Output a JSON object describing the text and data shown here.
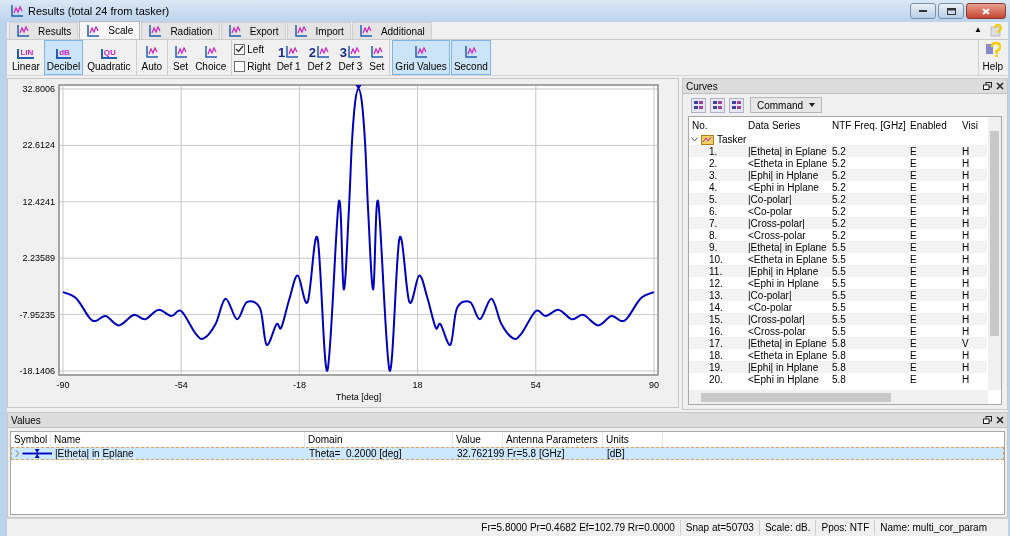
{
  "window": {
    "title": "Results (total 24 from tasker)"
  },
  "tabs": [
    {
      "label": "Results",
      "selected": false
    },
    {
      "label": "Scale",
      "selected": true
    },
    {
      "label": "Radiation",
      "selected": false
    },
    {
      "label": "Export",
      "selected": false
    },
    {
      "label": "Import",
      "selected": false
    },
    {
      "label": "Additional",
      "selected": false
    }
  ],
  "tab_bar_right": {
    "collapse": "▲"
  },
  "toolbar": {
    "groups": [
      [
        {
          "kind": "button",
          "label": "Linear",
          "icon_text": "LIN",
          "selected": false
        },
        {
          "kind": "button",
          "label": "Decibel",
          "icon_text": "dB",
          "selected": true
        },
        {
          "kind": "button",
          "label": "Quadratic",
          "icon_text": "QU",
          "selected": false
        }
      ],
      [
        {
          "kind": "button",
          "label": "Auto",
          "selected": false
        }
      ],
      [
        {
          "kind": "button",
          "label": "Set",
          "selected": false
        },
        {
          "kind": "button",
          "label": "Choice",
          "selected": false
        }
      ],
      [
        {
          "kind": "checkbox",
          "label": "Left",
          "checked": true
        },
        {
          "kind": "checkbox",
          "label": "Right",
          "checked": false
        },
        {
          "kind": "button",
          "label": "Def 1",
          "icon_text": "1",
          "selected": false
        },
        {
          "kind": "button",
          "label": "Def 2",
          "icon_text": "2",
          "selected": false
        },
        {
          "kind": "button",
          "label": "Def 3",
          "icon_text": "3",
          "selected": false
        },
        {
          "kind": "button",
          "label": "Set",
          "selected": false
        }
      ],
      [
        {
          "kind": "button",
          "label": "Grid Values",
          "selected": true
        },
        {
          "kind": "button",
          "label": "Second",
          "selected": true
        }
      ]
    ],
    "help": {
      "label": "Help"
    }
  },
  "chart": {
    "chart_data": {
      "type": "line",
      "grid": true,
      "xlabel": "Theta [deg]",
      "x": [
        -90,
        -86,
        -82,
        -80,
        -77,
        -73,
        -68.5,
        -65,
        -61,
        -57,
        -54,
        -49.5,
        -47,
        -43.5,
        -40.5,
        -37,
        -34,
        -30,
        -28,
        -25,
        -23.5,
        -21,
        -18.5,
        -15.5,
        -12.5,
        -9.5,
        -6,
        -4.5,
        -3,
        -2,
        -1,
        0,
        1,
        2,
        3,
        4.5,
        6,
        9.5,
        12.5,
        15.5,
        18.5,
        21,
        23.5,
        25,
        28,
        30,
        34,
        37,
        40.5,
        43.5,
        47,
        49.5,
        54,
        57,
        61,
        65,
        68.5,
        73,
        77,
        80,
        82,
        86,
        90
      ],
      "series": [
        {
          "color": "#0000c0",
          "values": [
            -3.9,
            -5,
            -8.5,
            -9.1,
            -8.2,
            -9.9,
            -8,
            -8.8,
            -7.1,
            -8.2,
            -7.3,
            -11.5,
            -12.2,
            -9.6,
            -5.1,
            -8.8,
            -5.7,
            -6.8,
            -13.4,
            -9.7,
            -10.3,
            -5,
            -0.9,
            -5.7,
            5.9,
            -18.1,
            12.4,
            -3.4,
            10,
            23,
            30.5,
            32.8,
            30.5,
            23,
            10,
            -3.4,
            12.4,
            -18.1,
            5.9,
            -5.7,
            -0.9,
            -5,
            -10.3,
            -9.7,
            -13.4,
            -6.8,
            -5.7,
            -8.8,
            -5.1,
            -9.6,
            -12.2,
            -11.5,
            -7.3,
            -8.2,
            -7.1,
            -8.8,
            -8,
            -9.9,
            -8.2,
            -9.1,
            -8.5,
            -5,
            -3.9
          ]
        }
      ],
      "xlim": [
        -90,
        90
      ],
      "ylim": [
        -18.1406,
        32.8006
      ],
      "xticks": [
        -90,
        -54,
        -18,
        18,
        54,
        90
      ],
      "yticks": [
        {
          "value": 32.8006,
          "label": "32.8006"
        },
        {
          "value": 22.6124,
          "label": "22.6124"
        },
        {
          "value": 12.4241,
          "label": "12.4241"
        },
        {
          "value": 2.23589,
          "label": "2.23589"
        },
        {
          "value": -7.95235,
          "label": "-7.95235"
        },
        {
          "value": -18.1406,
          "label": "-18.1406"
        }
      ]
    }
  },
  "curves": {
    "title": "Curves",
    "command": "Command",
    "columns": [
      "No.",
      "Data Series",
      "NTF Freq. [GHz]",
      "Enabled",
      "Visi"
    ],
    "tree": {
      "label": "Tasker",
      "expanded": true,
      "children": [
        {
          "no": "1.",
          "series": "|Etheta| in Eplane",
          "freq": "5.2",
          "enabled": "E",
          "visible": "H"
        },
        {
          "no": "2.",
          "series": "<Etheta in Eplane",
          "freq": "5.2",
          "enabled": "E",
          "visible": "H"
        },
        {
          "no": "3.",
          "series": "|Ephi| in Hplane",
          "freq": "5.2",
          "enabled": "E",
          "visible": "H"
        },
        {
          "no": "4.",
          "series": "<Ephi in Hplane",
          "freq": "5.2",
          "enabled": "E",
          "visible": "H"
        },
        {
          "no": "5.",
          "series": "|Co-polar|",
          "freq": "5.2",
          "enabled": "E",
          "visible": "H"
        },
        {
          "no": "6.",
          "series": "<Co-polar",
          "freq": "5.2",
          "enabled": "E",
          "visible": "H"
        },
        {
          "no": "7.",
          "series": "|Cross-polar|",
          "freq": "5.2",
          "enabled": "E",
          "visible": "H"
        },
        {
          "no": "8.",
          "series": "<Cross-polar",
          "freq": "5.2",
          "enabled": "E",
          "visible": "H"
        },
        {
          "no": "9.",
          "series": "|Etheta| in Eplane",
          "freq": "5.5",
          "enabled": "E",
          "visible": "H"
        },
        {
          "no": "10.",
          "series": "<Etheta in Eplane",
          "freq": "5.5",
          "enabled": "E",
          "visible": "H"
        },
        {
          "no": "11.",
          "series": "|Ephi| in Hplane",
          "freq": "5.5",
          "enabled": "E",
          "visible": "H"
        },
        {
          "no": "12.",
          "series": "<Ephi in Hplane",
          "freq": "5.5",
          "enabled": "E",
          "visible": "H"
        },
        {
          "no": "13.",
          "series": "|Co-polar|",
          "freq": "5.5",
          "enabled": "E",
          "visible": "H"
        },
        {
          "no": "14.",
          "series": "<Co-polar",
          "freq": "5.5",
          "enabled": "E",
          "visible": "H"
        },
        {
          "no": "15.",
          "series": "|Cross-polar|",
          "freq": "5.5",
          "enabled": "E",
          "visible": "H"
        },
        {
          "no": "16.",
          "series": "<Cross-polar",
          "freq": "5.5",
          "enabled": "E",
          "visible": "H"
        },
        {
          "no": "17.",
          "series": "|Etheta| in Eplane",
          "freq": "5.8",
          "enabled": "E",
          "visible": "V"
        },
        {
          "no": "18.",
          "series": "<Etheta in Eplane",
          "freq": "5.8",
          "enabled": "E",
          "visible": "H"
        },
        {
          "no": "19.",
          "series": "|Ephi| in Hplane",
          "freq": "5.8",
          "enabled": "E",
          "visible": "H"
        },
        {
          "no": "20.",
          "series": "<Ephi in Hplane",
          "freq": "5.8",
          "enabled": "E",
          "visible": "H"
        }
      ]
    }
  },
  "values": {
    "title": "Values",
    "columns": [
      "Symbol",
      "Name",
      "Domain",
      "Value",
      "Antenna Parameters",
      "Units"
    ],
    "rows": [
      {
        "selected": true,
        "name": "|Etheta| in Eplane",
        "domain": "Theta=  0.2000 [deg]",
        "value": "32.762199",
        "antenna": "Fr=5.8 [GHz]",
        "units": "[dB]"
      }
    ]
  },
  "status_bar": [
    "Fr=5.8000 Pr=0.4682 Ef=102.79 Rr=0.0000",
    "Snap at=50703",
    "Scale: dB.",
    "Ppos: NTF",
    "Name: multi_cor_param"
  ]
}
